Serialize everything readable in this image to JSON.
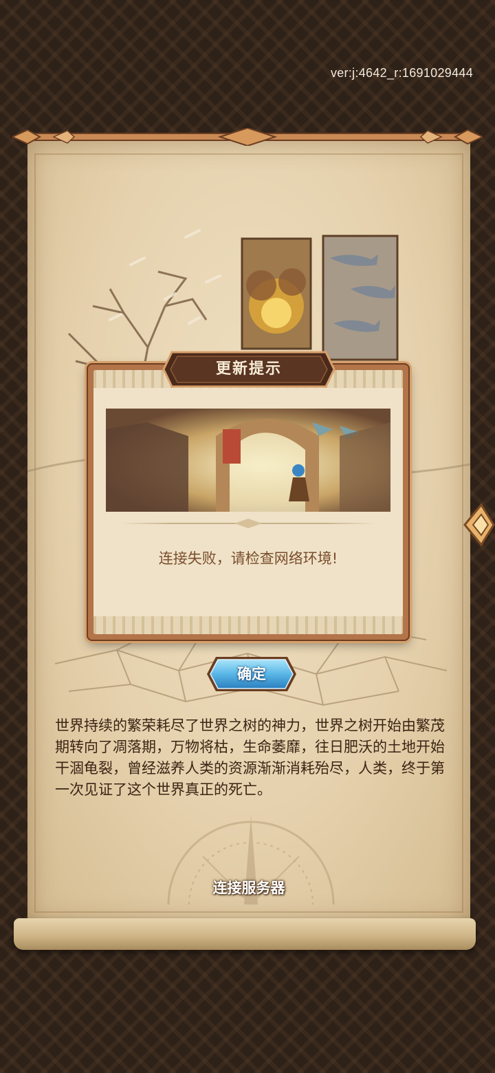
{
  "version_text": "ver:j:4642_r:1691029444",
  "dialog": {
    "title": "更新提示",
    "message": "连接失败，请检查网络环境!",
    "confirm_label": "确定"
  },
  "story_text": "世界持续的繁荣耗尽了世界之树的神力，世界之树开始由繁茂期转向了凋落期，万物将枯，生命萎靡，往日肥沃的土地开始干涸龟裂，曾经滋养人类的资源渐渐消耗殆尽，人类，终于第一次见证了这个世界真正的死亡。",
  "status_text": "连接服务器",
  "colors": {
    "background": "#2e2118",
    "parchment": "#e5d1ad",
    "dialog_frame": "#b27448",
    "dialog_bg": "#efe2c8",
    "message_text": "#7a4e2c",
    "button_blue": "#59b6e6",
    "title_plate": "#4a2a1a"
  },
  "icons": [
    "scroll-rod",
    "compass-decoration",
    "next-page-arrow-icon",
    "divider-gem-icon"
  ]
}
